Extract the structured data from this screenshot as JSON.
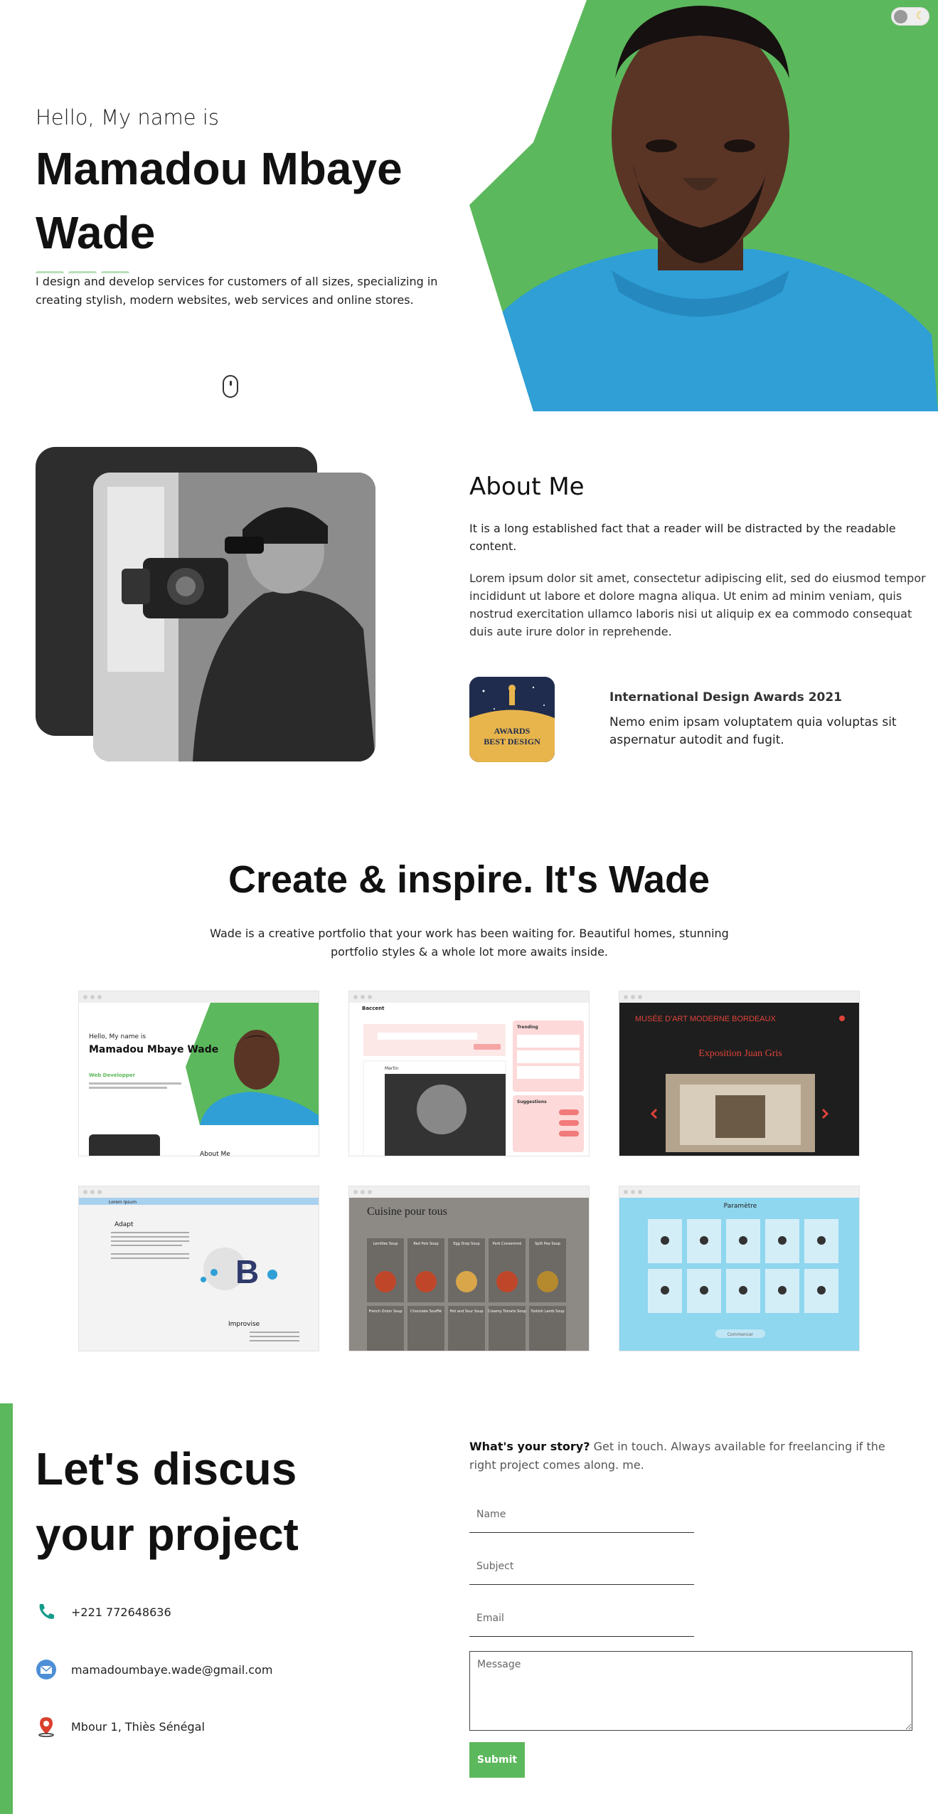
{
  "theme": {
    "accent": "#5cb85c",
    "dark_card": "#2d2d2d",
    "toggle_moon": "#f1c232"
  },
  "hero": {
    "greeting": "Hello, My name is",
    "name": "Mamadou Mbaye Wade",
    "intro": "I design and develop services for customers of all sizes, specializing in creating stylish, modern websites, web services and online stores.",
    "toggle_icon": "moon-icon",
    "scroll_icon": "mouse-icon"
  },
  "about": {
    "title": "About Me",
    "p1": "It is a long established fact that a reader will be distracted by the readable content.",
    "p2": "Lorem ipsum dolor sit amet, consectetur adipiscing elit, sed do eiusmod tempor incididunt ut labore et dolore magna aliqua. Ut enim ad minim veniam, quis nostrud exercitation ullamco laboris nisi ut aliquip ex ea commodo consequat duis aute irure dolor in reprehende.",
    "award": {
      "badge_line1": "AWARDS",
      "badge_line2": "BEST DESIGN",
      "title": "International Design Awards 2021",
      "text": "Nemo enim ipsam voluptatem quia voluptas sit aspernatur autodit and fugit."
    }
  },
  "portfolio": {
    "title": "Create & inspire. It's Wade",
    "subtitle": "Wade is a creative portfolio that your work has been waiting for. Beautiful homes, stunning portfolio styles & a whole lot more awaits inside.",
    "cards": {
      "c1": {
        "greet": "Hello, My name is",
        "name": "Mamadou Mbaye Wade",
        "role": "Web Developper",
        "about": "About Me"
      },
      "c2": {
        "app": "Baccent",
        "trending": "Trending",
        "suggestions": "Suggestions",
        "post_user": "Martin"
      },
      "c3": {
        "museum": "MUSÉE D'ART MODERNE BORDEAUX",
        "expo": "Exposition Juan Gris"
      },
      "c4": {
        "brand": "Lorem Ipsum",
        "h1": "Adapt",
        "h2": "Improvise"
      },
      "c5": {
        "title": "Cuisine pour tous",
        "soups": [
          "Lentilles Soup",
          "Red Pois Soup",
          "Egg Drop Soup",
          "Pork Consommé",
          "Split Pea Soup",
          "French Onion Soup",
          "Chocolate Soufflé",
          "Hot and Sour Soup",
          "Creamy Tomato Soup",
          "Turkish Lamb Soup"
        ]
      },
      "c6": {
        "title": "Paramètre",
        "button": "Commencer"
      }
    }
  },
  "contact": {
    "title": "Let's discus your project",
    "phone": "+221 772648636",
    "email": "mamadoumbaye.wade@gmail.com",
    "address": "Mbour 1, Thiès Sénégal",
    "story_bold": "What's your story?",
    "story_rest": " Get in touch. Always available for freelancing if the right project comes along. me.",
    "name_ph": "Name",
    "subject_ph": "Subject",
    "email_ph": "Email",
    "message_ph": "Message",
    "submit": "Submit"
  }
}
